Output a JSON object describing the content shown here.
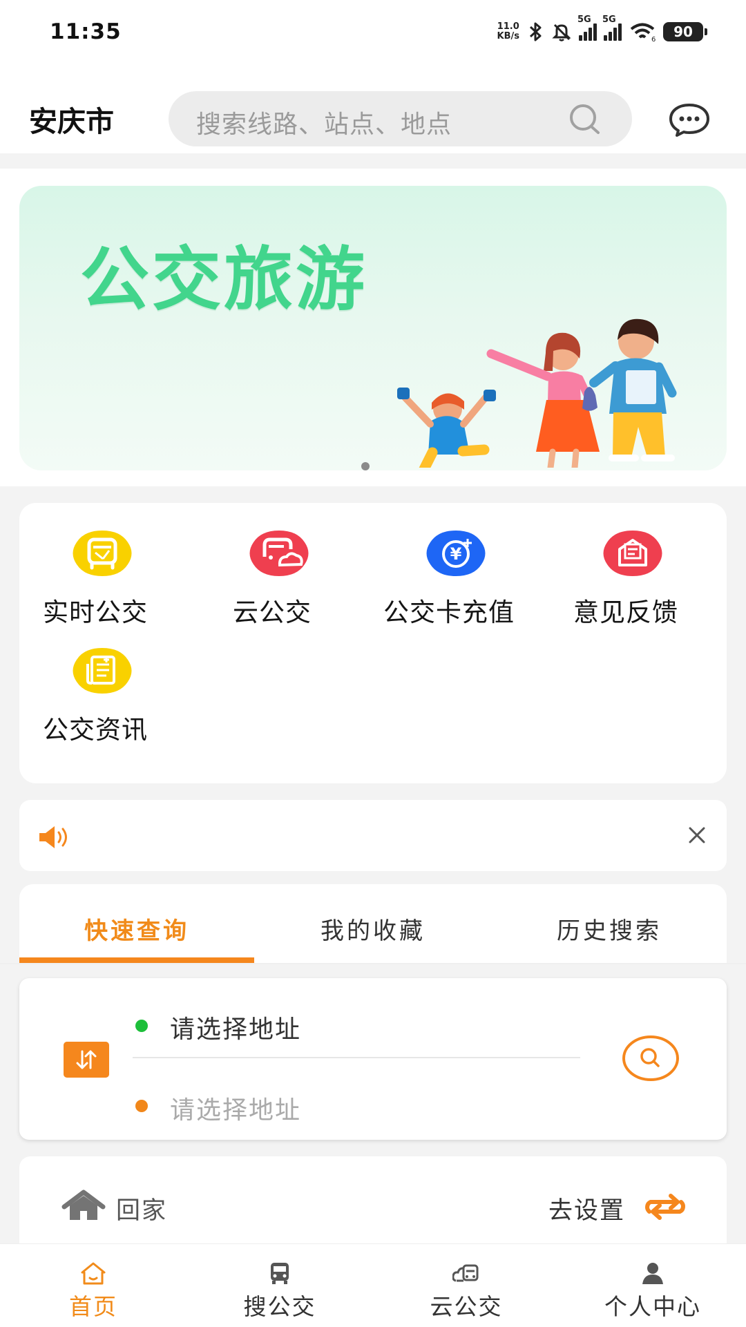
{
  "status_bar": {
    "time": "11:35",
    "net_speed_top": "11.0",
    "net_speed_bottom": "KB/s",
    "signal_1_label": "5G",
    "signal_2_label": "5G",
    "battery": "90",
    "icons": [
      "bluetooth-icon",
      "mute-icon",
      "signal-icon",
      "wifi-icon",
      "battery-icon"
    ]
  },
  "header": {
    "city": "安庆市",
    "search_placeholder": "搜索线路、站点、地点"
  },
  "banner": {
    "title": "公交旅游"
  },
  "functions": [
    {
      "label": "实时公交",
      "icon": "realtime-bus-icon",
      "color": "#f9d100"
    },
    {
      "label": "云公交",
      "icon": "cloud-bus-icon",
      "color": "#ef3f4f"
    },
    {
      "label": "公交卡充值",
      "icon": "card-recharge-icon",
      "color": "#1e66f5"
    },
    {
      "label": "意见反馈",
      "icon": "feedback-icon",
      "color": "#ef3f4f"
    },
    {
      "label": "公交资讯",
      "icon": "bus-news-icon",
      "color": "#f9d100"
    }
  ],
  "tabs": [
    {
      "label": "快速查询",
      "active": true
    },
    {
      "label": "我的收藏",
      "active": false
    },
    {
      "label": "历史搜索",
      "active": false
    }
  ],
  "query": {
    "start_placeholder": "请选择地址",
    "end_placeholder": "请选择地址"
  },
  "home_shortcut": {
    "label": "回家",
    "action": "去设置"
  },
  "bottom_nav": [
    {
      "label": "首页",
      "icon": "home-icon",
      "active": true
    },
    {
      "label": "搜公交",
      "icon": "bus-icon",
      "active": false
    },
    {
      "label": "云公交",
      "icon": "cloud-bus-icon",
      "active": false
    },
    {
      "label": "个人中心",
      "icon": "person-icon",
      "active": false
    }
  ],
  "colors": {
    "accent": "#f18b1a",
    "green": "#42d58c"
  }
}
